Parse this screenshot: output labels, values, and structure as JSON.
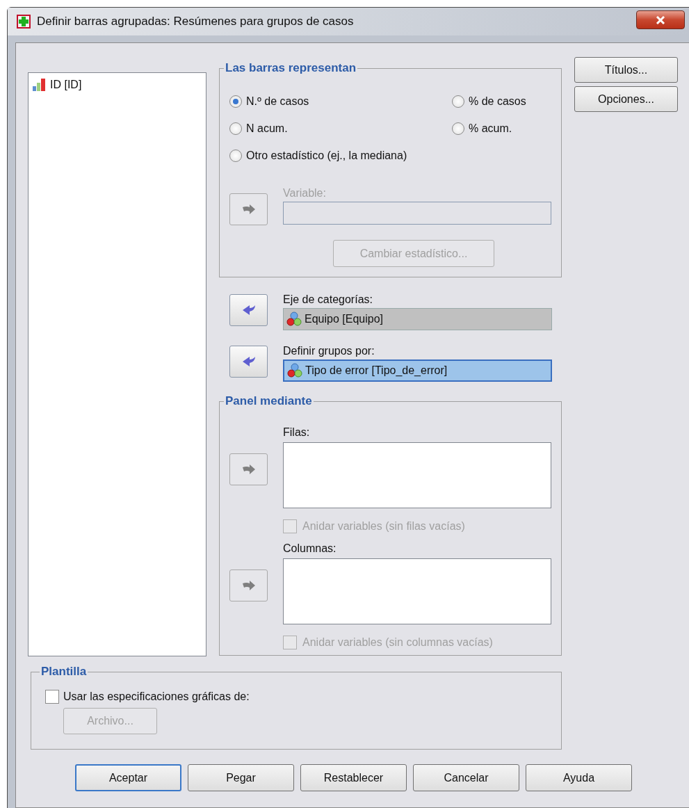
{
  "window": {
    "title": "Definir barras agrupadas: Resúmenes para grupos de casos"
  },
  "variable_list": {
    "items": [
      {
        "label": "ID [ID]",
        "selected": false
      }
    ]
  },
  "bars_represent": {
    "legend": "Las barras representan",
    "options": [
      {
        "label": "N.º de casos",
        "selected": true
      },
      {
        "label": "% de casos",
        "selected": false
      },
      {
        "label": "N acum.",
        "selected": false
      },
      {
        "label": "% acum.",
        "selected": false
      },
      {
        "label": "Otro estadístico (ej., la mediana)",
        "selected": false
      }
    ],
    "arrow": {
      "kind": "right",
      "disabled": true
    },
    "variable": {
      "label": "Variable:",
      "disabled": true
    },
    "change_button": {
      "label": "Cambiar estadístico...",
      "disabled": true
    }
  },
  "category_axis": {
    "label": "Eje de categorías:",
    "value": "Equipo [Equipo]",
    "focused": false,
    "arrow": {
      "kind": "left",
      "disabled": false
    }
  },
  "group_by": {
    "label": "Definir grupos por:",
    "value": "Tipo de error [Tipo_de_error]",
    "focused": true,
    "arrow": {
      "kind": "left",
      "disabled": false
    }
  },
  "panel": {
    "legend": "Panel mediante",
    "lists": [
      {
        "label": "Filas:",
        "arrow": {
          "kind": "right",
          "disabled": true
        },
        "nest": {
          "label": "Anidar variables (sin filas vacías)",
          "checked": false,
          "disabled": true
        }
      },
      {
        "label": "Columnas:",
        "arrow": {
          "kind": "right",
          "disabled": true
        },
        "nest": {
          "label": "Anidar variables (sin columnas vacías)",
          "checked": false,
          "disabled": true
        }
      }
    ]
  },
  "template": {
    "legend": "Plantilla",
    "use": {
      "label": "Usar las especificaciones gráficas de:",
      "checked": false
    },
    "file_button": {
      "label": "Archivo...",
      "disabled": true
    }
  },
  "side_buttons": [
    {
      "label": "Títulos..."
    },
    {
      "label": "Opciones..."
    }
  ],
  "buttons": [
    {
      "label": "Aceptar",
      "default": true
    },
    {
      "label": "Pegar",
      "default": false
    },
    {
      "label": "Restablecer",
      "default": false
    },
    {
      "label": "Cancelar",
      "default": false
    },
    {
      "label": "Ayuda",
      "default": false
    }
  ]
}
